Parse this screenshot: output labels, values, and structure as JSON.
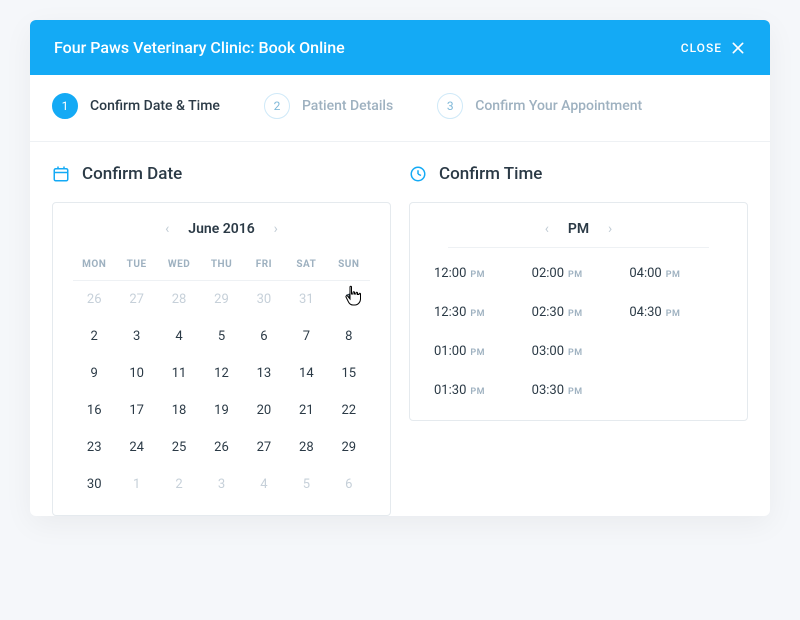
{
  "header": {
    "title": "Four Paws Veterinary Clinic: Book Online",
    "close_label": "CLOSE"
  },
  "steps": [
    {
      "num": "1",
      "label": "Confirm Date & Time",
      "active": true
    },
    {
      "num": "2",
      "label": "Patient Details",
      "active": false
    },
    {
      "num": "3",
      "label": "Confirm Your Appointment",
      "active": false
    }
  ],
  "date_section": {
    "title": "Confirm Date",
    "month_label": "June 2016",
    "day_headers": [
      "MON",
      "TUE",
      "WED",
      "THU",
      "FRI",
      "SAT",
      "SUN"
    ],
    "weeks": [
      [
        {
          "d": "26",
          "out": true
        },
        {
          "d": "27",
          "out": true
        },
        {
          "d": "28",
          "out": true
        },
        {
          "d": "29",
          "out": true
        },
        {
          "d": "30",
          "out": true
        },
        {
          "d": "31",
          "out": true
        },
        {
          "d": "1",
          "out": false
        }
      ],
      [
        {
          "d": "2"
        },
        {
          "d": "3"
        },
        {
          "d": "4"
        },
        {
          "d": "5"
        },
        {
          "d": "6"
        },
        {
          "d": "7"
        },
        {
          "d": "8"
        }
      ],
      [
        {
          "d": "9"
        },
        {
          "d": "10"
        },
        {
          "d": "11"
        },
        {
          "d": "12"
        },
        {
          "d": "13"
        },
        {
          "d": "14"
        },
        {
          "d": "15"
        }
      ],
      [
        {
          "d": "16"
        },
        {
          "d": "17"
        },
        {
          "d": "18"
        },
        {
          "d": "19"
        },
        {
          "d": "20"
        },
        {
          "d": "21"
        },
        {
          "d": "22"
        }
      ],
      [
        {
          "d": "23"
        },
        {
          "d": "24"
        },
        {
          "d": "25"
        },
        {
          "d": "26"
        },
        {
          "d": "27"
        },
        {
          "d": "28"
        },
        {
          "d": "29"
        }
      ],
      [
        {
          "d": "30"
        },
        {
          "d": "1",
          "out": true
        },
        {
          "d": "2",
          "out": true
        },
        {
          "d": "3",
          "out": true
        },
        {
          "d": "4",
          "out": true
        },
        {
          "d": "5",
          "out": true
        },
        {
          "d": "6",
          "out": true
        }
      ]
    ]
  },
  "time_section": {
    "title": "Confirm Time",
    "period_label": "PM",
    "slots": [
      {
        "t": "12:00",
        "p": "PM"
      },
      {
        "t": "12:30",
        "p": "PM"
      },
      {
        "t": "01:00",
        "p": "PM"
      },
      {
        "t": "01:30",
        "p": "PM"
      },
      {
        "t": "02:00",
        "p": "PM"
      },
      {
        "t": "02:30",
        "p": "PM"
      },
      {
        "t": "03:00",
        "p": "PM"
      },
      {
        "t": "03:30",
        "p": "PM"
      },
      {
        "t": "04:00",
        "p": "PM"
      },
      {
        "t": "04:30",
        "p": "PM"
      }
    ]
  },
  "colors": {
    "accent": "#14aaf5"
  }
}
